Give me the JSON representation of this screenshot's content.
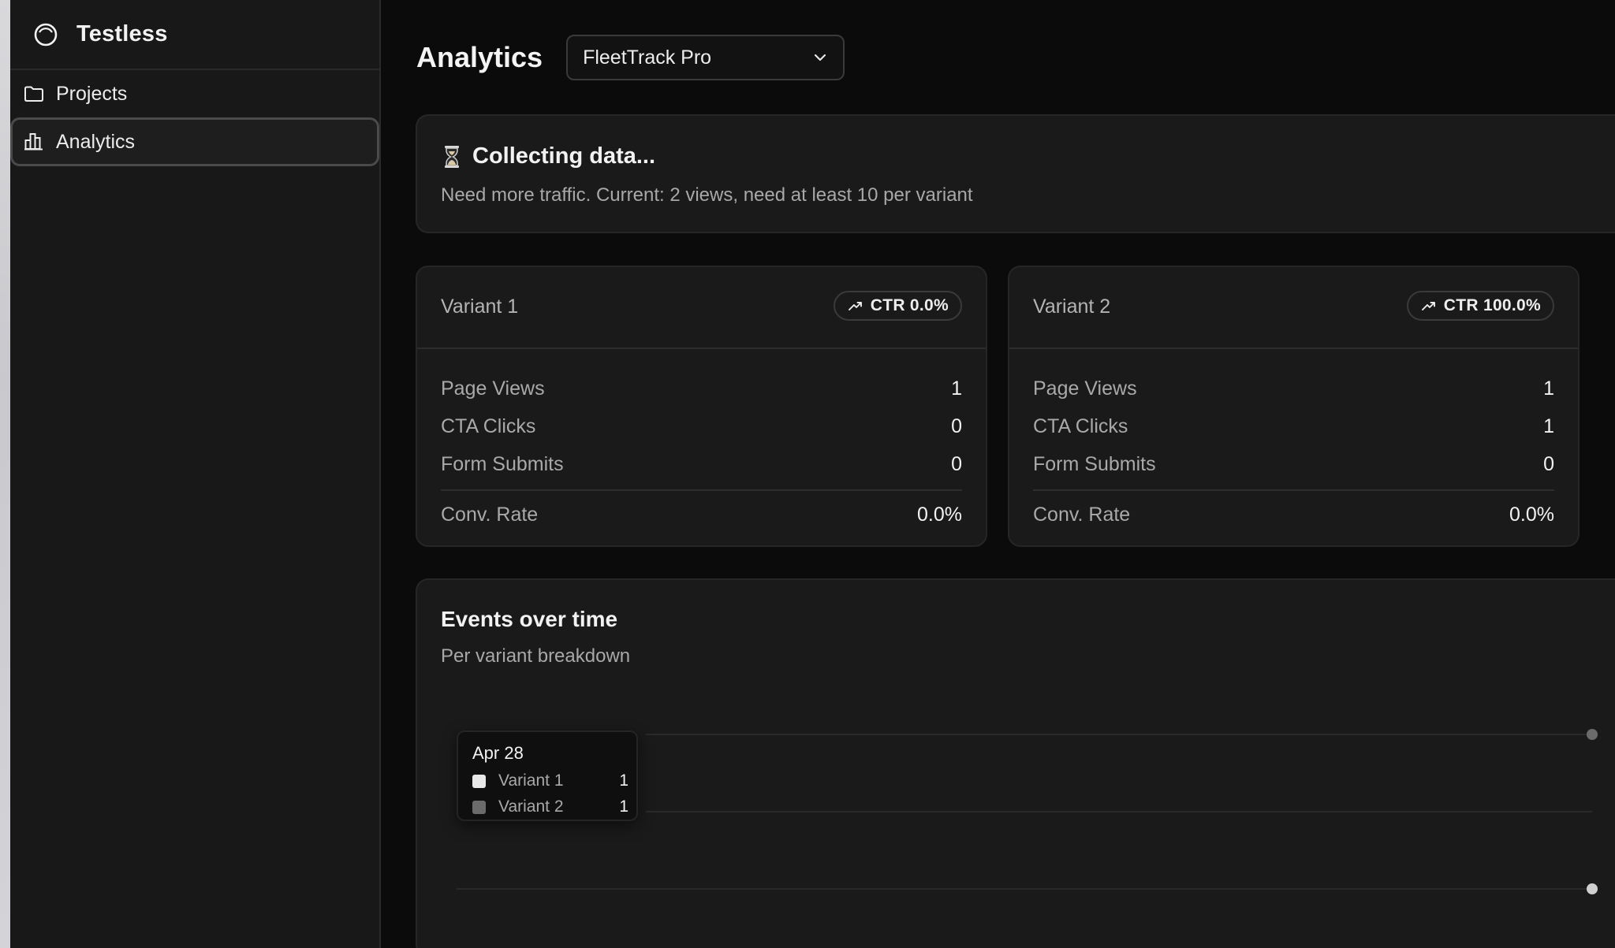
{
  "app": {
    "name": "Testless"
  },
  "sidebar": {
    "items": [
      {
        "label": "Projects",
        "icon": "folder-icon",
        "active": false
      },
      {
        "label": "Analytics",
        "icon": "bar-chart-icon",
        "active": true
      }
    ]
  },
  "header": {
    "title": "Analytics",
    "project_select": {
      "value": "FleetTrack Pro"
    }
  },
  "alert": {
    "icon": "hourglass-icon",
    "title": "Collecting data...",
    "message": "Need more traffic. Current: 2 views, need at least 10 per variant"
  },
  "variants": [
    {
      "name": "Variant 1",
      "ctr": "CTR 0.0%",
      "metrics": [
        {
          "label": "Page Views",
          "value": "1"
        },
        {
          "label": "CTA Clicks",
          "value": "0"
        },
        {
          "label": "Form Submits",
          "value": "0"
        }
      ],
      "conv": {
        "label": "Conv. Rate",
        "value": "0.0%"
      }
    },
    {
      "name": "Variant 2",
      "ctr": "CTR 100.0%",
      "metrics": [
        {
          "label": "Page Views",
          "value": "1"
        },
        {
          "label": "CTA Clicks",
          "value": "1"
        },
        {
          "label": "Form Submits",
          "value": "0"
        }
      ],
      "conv": {
        "label": "Conv. Rate",
        "value": "0.0%"
      }
    }
  ],
  "events_chart": {
    "title": "Events over time",
    "subtitle": "Per variant breakdown",
    "tooltip": {
      "date": "Apr 28",
      "rows": [
        {
          "name": "Variant 1",
          "value": "1",
          "color": "#e8e8e8"
        },
        {
          "name": "Variant 2",
          "value": "1",
          "color": "#6b6b6b"
        }
      ]
    }
  },
  "colors": {
    "background": "#0b0b0b",
    "sidebar": "#181818",
    "card": "#1a1a1a",
    "variant_1": "#e8e8e8",
    "variant_2": "#6b6b6b"
  },
  "chart_data": {
    "type": "line",
    "x": [
      "Apr 28"
    ],
    "series": [
      {
        "name": "Variant 1",
        "values": [
          1
        ]
      },
      {
        "name": "Variant 2",
        "values": [
          1
        ]
      }
    ],
    "grid": true
  }
}
